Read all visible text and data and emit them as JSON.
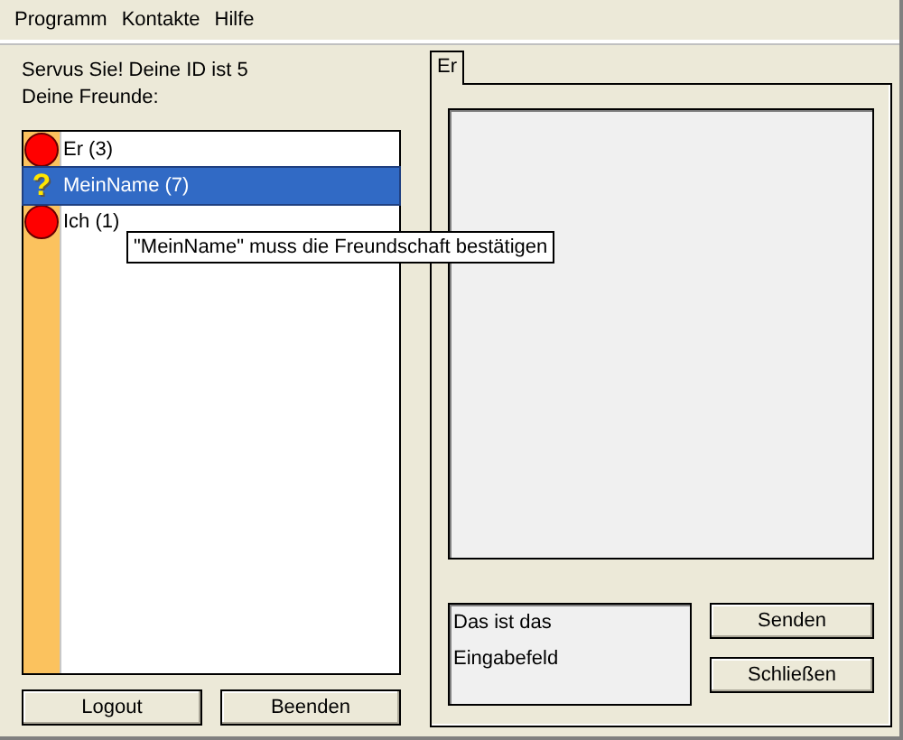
{
  "menu": [
    "Programm",
    "Kontakte",
    "Hilfe"
  ],
  "greeting": "Servus Sie! Deine ID ist 5",
  "friends_label": "Deine Freunde:",
  "friends": [
    {
      "name": "Er (3)",
      "kind": "offline",
      "selected": false
    },
    {
      "name": "MeinName (7)",
      "kind": "pending",
      "selected": true
    },
    {
      "name": "Ich (1)",
      "kind": "offline",
      "selected": false
    }
  ],
  "status_icon_text": "?",
  "tooltip": "\"MeinName\" muss die Freundschaft bestätigen",
  "left_buttons": [
    "Logout",
    "Beenden"
  ],
  "tabs": [
    {
      "label": "Er",
      "selected": true
    }
  ],
  "input": {
    "value": "Das ist das\nEingabefeld"
  },
  "right_buttons": [
    "Senden",
    "Schließen"
  ]
}
